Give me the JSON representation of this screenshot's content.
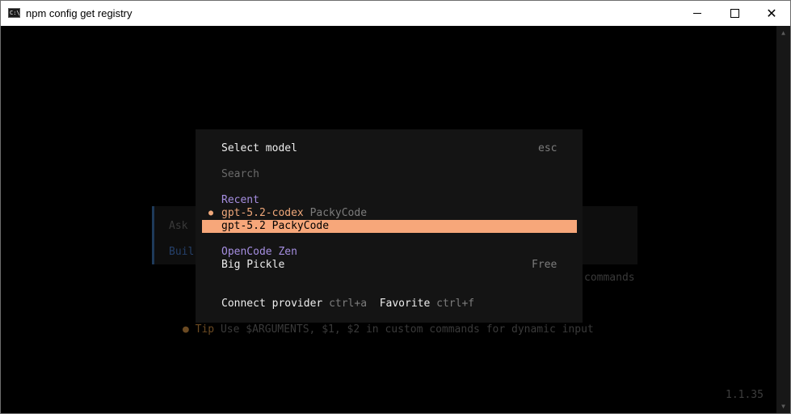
{
  "window": {
    "title": "npm config get registry",
    "icon_label": "C:\\",
    "controls": {
      "minimize": "minimize-icon",
      "maximize": "maximize-icon",
      "close": "close-icon"
    }
  },
  "background": {
    "ask_text": "Ask",
    "build_text": "Buil",
    "commands_text": "commands",
    "tip_bullet": "●",
    "tip_label": "Tip",
    "tip_text": "Use $ARGUMENTS, $1, $2 in custom commands for dynamic input",
    "version": "1.1.35"
  },
  "dialog": {
    "title": "Select model",
    "esc": "esc",
    "search_placeholder": "Search",
    "groups": {
      "recent": {
        "label": "Recent",
        "items": [
          {
            "bullet": "●",
            "model": "gpt-5.2-codex",
            "provider": "PackyCode"
          },
          {
            "model": "gpt-5.2",
            "provider": "PackyCode",
            "selected": true
          }
        ]
      },
      "zen": {
        "label": "OpenCode Zen",
        "items": [
          {
            "model": "Big Pickle",
            "price": "Free"
          }
        ]
      }
    },
    "footer": {
      "connect_label": "Connect provider",
      "connect_key": "ctrl+a",
      "favorite_label": "Favorite",
      "favorite_key": "ctrl+f"
    }
  },
  "colors": {
    "accent": "#f7a77a",
    "group_label": "#a58ee0",
    "dialog_bg": "#141414",
    "terminal_bg": "#000000"
  }
}
